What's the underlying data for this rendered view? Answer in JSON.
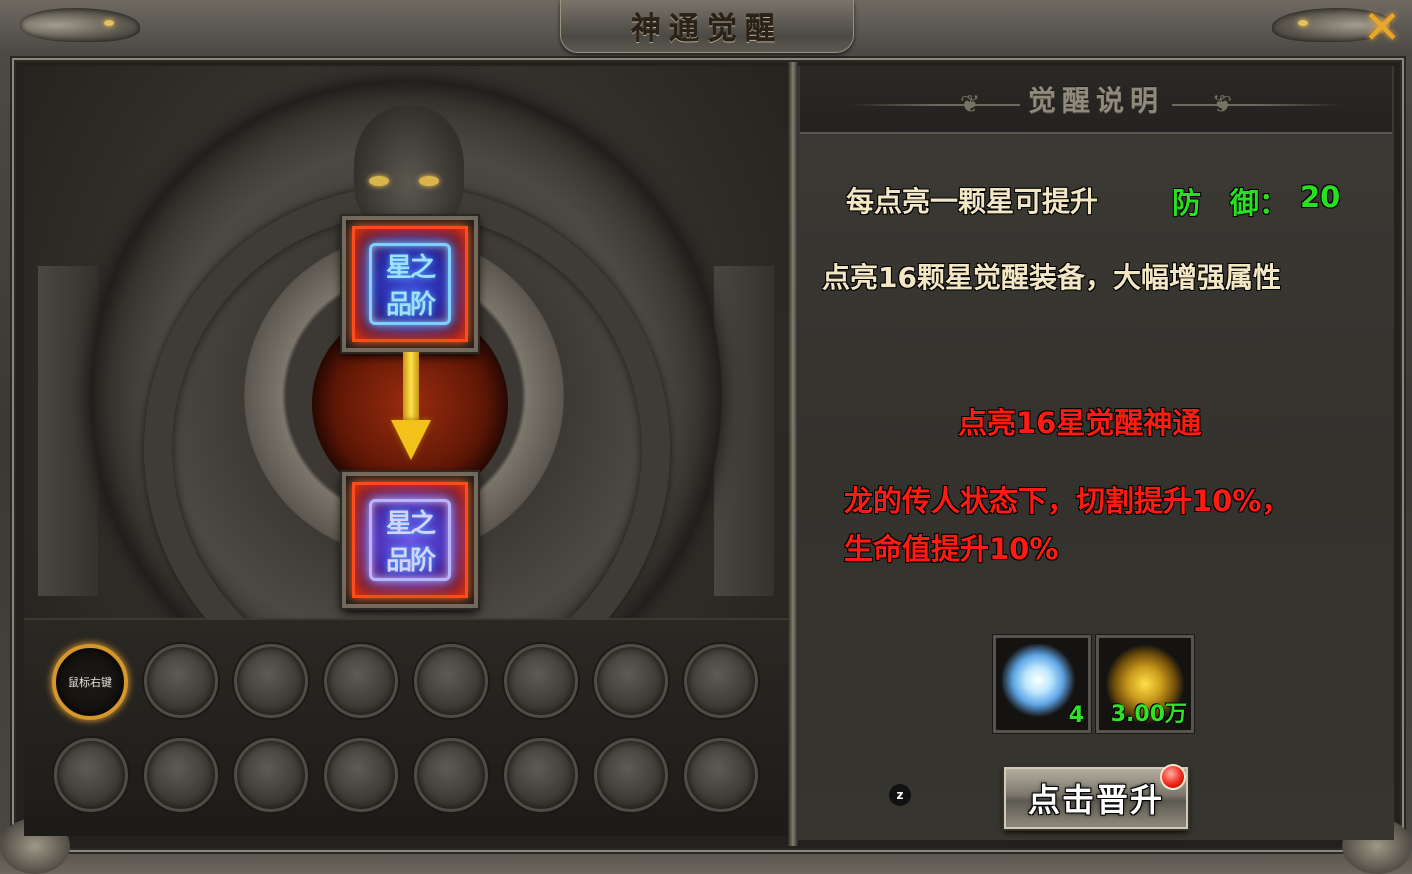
{
  "window": {
    "title": "神通觉醒",
    "close_icon": "close-x-icon"
  },
  "left": {
    "upgrade_from_seal": "星之\n品阶",
    "upgrade_to_seal": "星之\n品阶",
    "slot_hint": "鼠标右键",
    "slots_total": 16,
    "slots_lit": 0
  },
  "right": {
    "header": "觉醒说明",
    "line1_prefix": "每点亮一颗星可提升",
    "line1_stat": "防　御：",
    "line1_value": "20",
    "line2": "点亮16颗星觉醒装备，大幅增强属性",
    "bonus_title": "点亮16星觉醒神通",
    "bonus_line1": "龙的传人状态下，切割提升10%，",
    "bonus_line2": "生命值提升10%",
    "costs": [
      {
        "icon": "crystal-icon",
        "amount": "4"
      },
      {
        "icon": "gold-ingot-icon",
        "amount": "3.00万"
      }
    ],
    "upgrade_button": "点击晋升",
    "hotkey_badge": "z"
  },
  "colors": {
    "cream_text": "#f3e6c4",
    "stat_green": "#27e11f",
    "bonus_red": "#ff1a12",
    "active_slot_gold": "#d6972a"
  }
}
